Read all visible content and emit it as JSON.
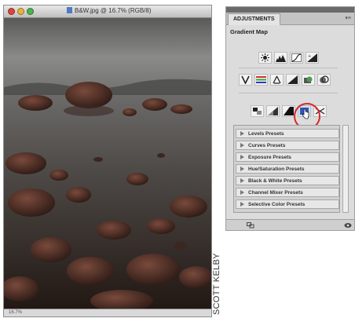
{
  "document_window": {
    "title": "B&W.jpg @ 16.7% (RGB/8)",
    "traffic_lights": [
      "#e0443b",
      "#e8b43a",
      "#4bb44a"
    ],
    "status_text": "16.7%"
  },
  "adjustments_panel": {
    "tab_label": "ADJUSTMENTS",
    "heading": "Gradient Map",
    "icon_rows": [
      [
        "brightness-contrast-icon",
        "levels-icon",
        "curves-icon",
        "exposure-icon"
      ],
      [
        "vibrance-icon",
        "hue-saturation-icon",
        "color-balance-icon",
        "black-white-icon",
        "photo-filter-icon",
        "channel-mixer-icon"
      ],
      [
        "invert-icon",
        "posterize-icon",
        "threshold-icon",
        "gradient-map-icon",
        "selective-color-icon"
      ]
    ],
    "highlighted_icon": "gradient-map-icon",
    "highlight_color": "#d62828",
    "presets": [
      "Levels Presets",
      "Curves Presets",
      "Exposure Presets",
      "Hue/Saturation Presets",
      "Black & White Presets",
      "Channel Mixer Presets",
      "Selective Color Presets"
    ]
  },
  "credit": "SCOTT KELBY"
}
